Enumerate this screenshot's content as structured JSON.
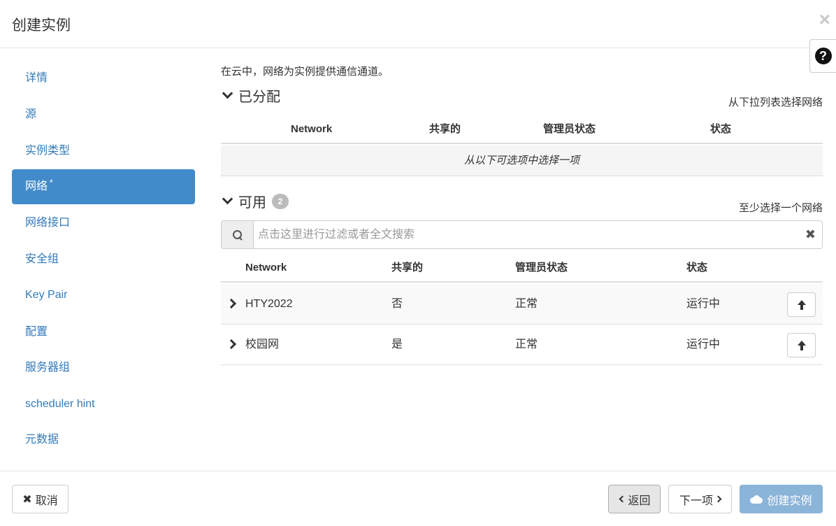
{
  "header": {
    "title": "创建实例",
    "close_glyph": "×"
  },
  "help": {
    "glyph": "?"
  },
  "sidebar": {
    "items": [
      {
        "label": "详情"
      },
      {
        "label": "源"
      },
      {
        "label": "实例类型"
      },
      {
        "label": "网络",
        "required_mark": "*",
        "active": true
      },
      {
        "label": "网络接口"
      },
      {
        "label": "安全组"
      },
      {
        "label": "Key Pair"
      },
      {
        "label": "配置"
      },
      {
        "label": "服务器组"
      },
      {
        "label": "scheduler hint"
      },
      {
        "label": "元数据"
      }
    ]
  },
  "main": {
    "intro": "在云中，网络为实例提供通信通道。",
    "allocated": {
      "title": "已分配",
      "hint": "从下拉列表选择网络",
      "columns": [
        "Network",
        "共享的",
        "管理员状态",
        "状态"
      ],
      "empty_text": "从以下可选项中选择一项"
    },
    "available": {
      "title": "可用",
      "count": "2",
      "hint": "至少选择一个网络",
      "search": {
        "placeholder": "点击这里进行过滤或者全文搜索",
        "clear_glyph": "✖"
      },
      "columns": [
        "Network",
        "共享的",
        "管理员状态",
        "状态"
      ],
      "rows": [
        {
          "network": "HTY2022",
          "shared": "否",
          "admin_state": "正常",
          "status": "运行中"
        },
        {
          "network": "校园网",
          "shared": "是",
          "admin_state": "正常",
          "status": "运行中"
        }
      ]
    }
  },
  "footer": {
    "cancel": {
      "icon": "✖",
      "label": "取消"
    },
    "back": {
      "label": "返回"
    },
    "next": {
      "label": "下一项"
    },
    "create": {
      "label": "创建实例"
    }
  },
  "colors": {
    "link": "#337ab7",
    "active_nav": "#428bca",
    "primary_disabled": "#8bb4d9"
  }
}
